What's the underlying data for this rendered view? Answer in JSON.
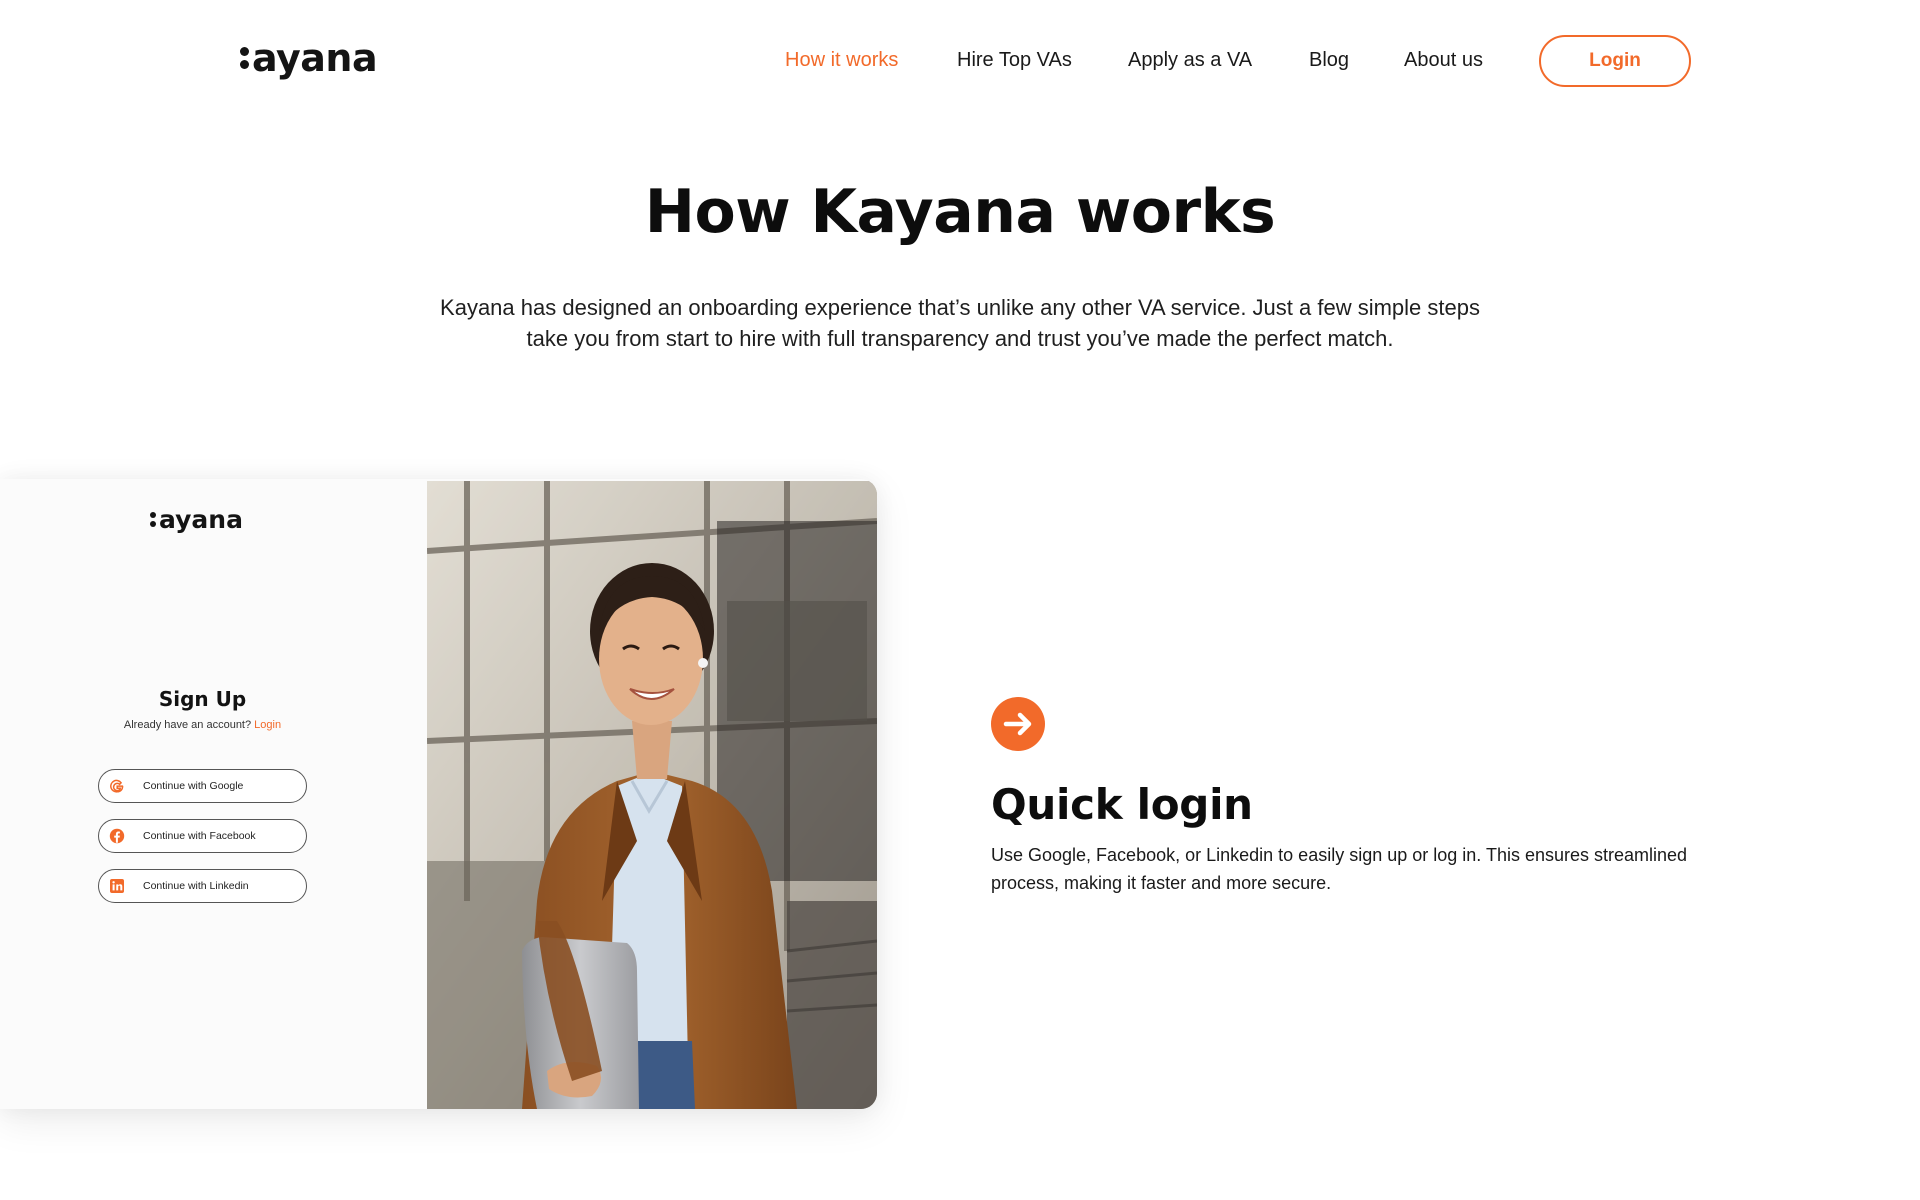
{
  "brand": {
    "logo_text": "ayana",
    "accent_color": "#f26a2a"
  },
  "nav": {
    "items": [
      {
        "label": "How it works",
        "active": true
      },
      {
        "label": "Hire Top VAs",
        "active": false
      },
      {
        "label": "Apply as a VA",
        "active": false
      },
      {
        "label": "Blog",
        "active": false
      },
      {
        "label": "About us",
        "active": false
      }
    ],
    "login_label": "Login"
  },
  "hero": {
    "title": "How Kayana works",
    "description_line1": "Kayana has designed an onboarding experience that’s unlike any other VA service. Just a few simple steps",
    "description_line2": "take you from start to hire with full transparency and trust you’ve made the perfect match."
  },
  "mockup": {
    "logo_text": "ayana",
    "signup_title": "Sign Up",
    "signup_prompt": "Already have an account?",
    "signup_login_link": "Login",
    "sso_buttons": [
      {
        "label": "Continue with Google",
        "icon": "google-icon"
      },
      {
        "label": "Continue with Facebook",
        "icon": "facebook-icon"
      },
      {
        "label": "Continue with Linkedin",
        "icon": "linkedin-icon"
      }
    ]
  },
  "feature": {
    "icon": "arrow-right-circle-icon",
    "title": "Quick login",
    "description_line1": "Use Google, Facebook, or Linkedin to easily sign up or log in. This ensures streamlined",
    "description_line2": "process, making it faster and more secure."
  }
}
